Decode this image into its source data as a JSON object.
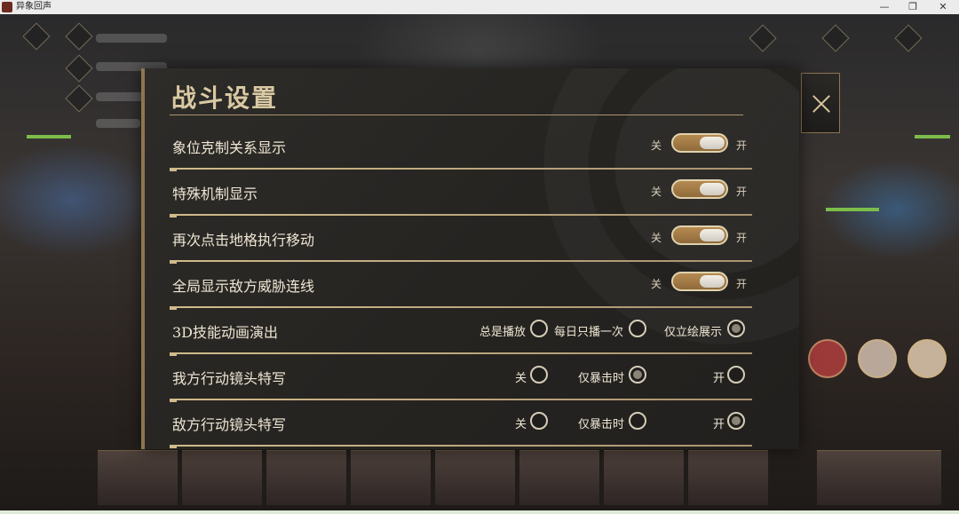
{
  "window": {
    "title": "异象回声",
    "minimize_icon": "minimize-icon",
    "restore_icon": "restore-icon",
    "close_icon": "close-icon"
  },
  "panel": {
    "title": "战斗设置",
    "close_icon": "close-x-icon",
    "accent_color": "#d1bb8b",
    "toggle_color": "#a37a45"
  },
  "settings": [
    {
      "label": "象位克制关系显示",
      "type": "toggle",
      "off_label": "关",
      "on_label": "开",
      "state": "on"
    },
    {
      "label": "特殊机制显示",
      "type": "toggle",
      "off_label": "关",
      "on_label": "开",
      "state": "on"
    },
    {
      "label": "再次点击地格执行移动",
      "type": "toggle",
      "off_label": "关",
      "on_label": "开",
      "state": "on"
    },
    {
      "label": "全局显示敌方威胁连线",
      "type": "toggle",
      "off_label": "关",
      "on_label": "开",
      "state": "on"
    },
    {
      "label": "3D技能动画演出",
      "type": "radio",
      "options": [
        "总是播放",
        "每日只播一次",
        "仅立绘展示"
      ],
      "selected": 2
    },
    {
      "label": "我方行动镜头特写",
      "type": "radio",
      "options": [
        "关",
        "仅暴击时",
        "开"
      ],
      "selected": 1
    },
    {
      "label": "敌方行动镜头特写",
      "type": "radio",
      "options": [
        "关",
        "仅暴击时",
        "开"
      ],
      "selected": 2
    }
  ]
}
